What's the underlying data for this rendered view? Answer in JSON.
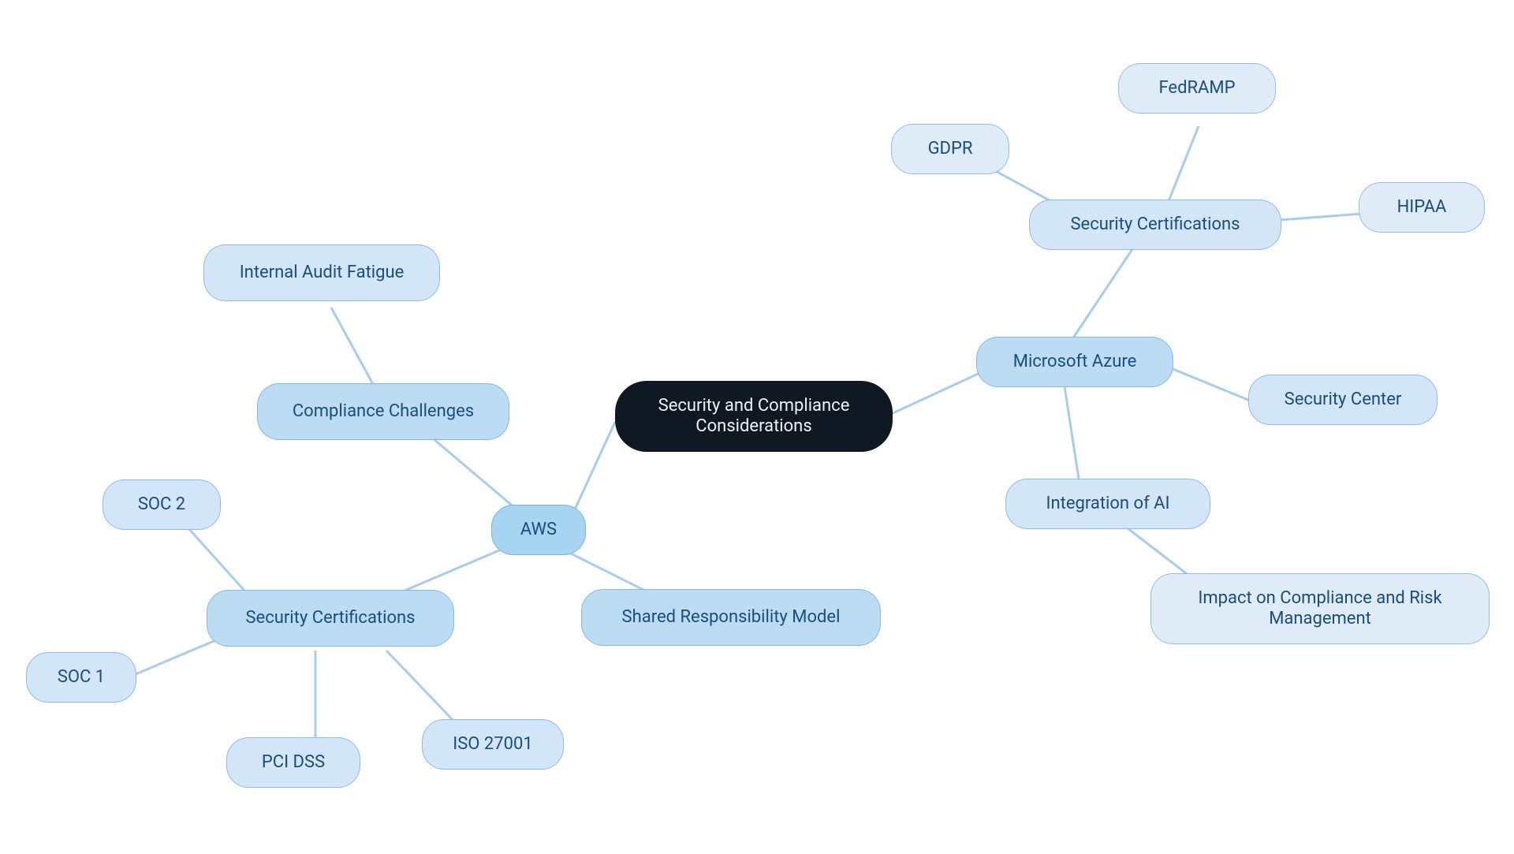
{
  "root": {
    "label": "Security and Compliance Considerations"
  },
  "aws": {
    "label": "AWS",
    "compliance_challenges": {
      "label": "Compliance Challenges"
    },
    "internal_audit_fatigue": {
      "label": "Internal Audit Fatigue"
    },
    "shared_responsibility": {
      "label": "Shared Responsibility Model"
    },
    "security_certifications": {
      "label": "Security Certifications"
    },
    "soc1": {
      "label": "SOC 1"
    },
    "soc2": {
      "label": "SOC 2"
    },
    "pci_dss": {
      "label": "PCI DSS"
    },
    "iso_27001": {
      "label": "ISO 27001"
    }
  },
  "azure": {
    "label": "Microsoft Azure",
    "security_center": {
      "label": "Security Center"
    },
    "security_certifications": {
      "label": "Security Certifications"
    },
    "gdpr": {
      "label": "GDPR"
    },
    "fedramp": {
      "label": "FedRAMP"
    },
    "hipaa": {
      "label": "HIPAA"
    },
    "integration_ai": {
      "label": "Integration of AI"
    },
    "ai_impact": {
      "label": "Impact on Compliance and Risk Management"
    }
  },
  "colors": {
    "root_bg": "#0f1823",
    "root_text": "#eaf2f9",
    "node_text": "#1a4d7a",
    "level1_bg": "#a7d4f0",
    "level2_bg": "#bcdcf4",
    "level3_bg": "#d3e6f7",
    "level4_bg": "#dfecf8",
    "edge": "#a7cdea"
  }
}
